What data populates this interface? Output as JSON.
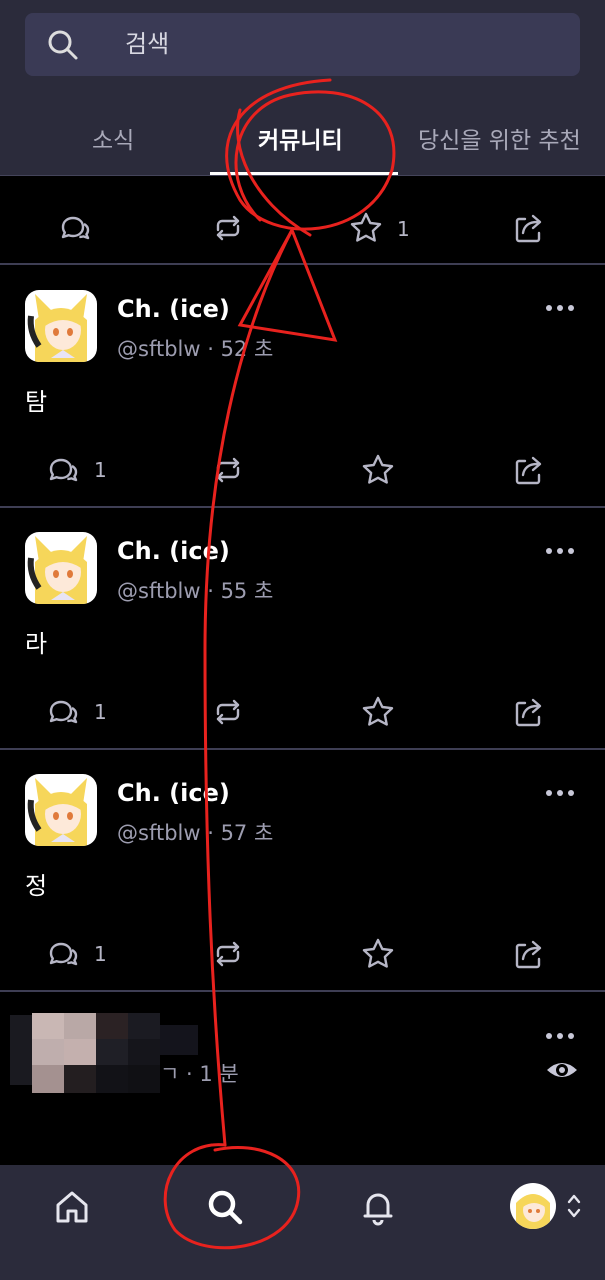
{
  "search": {
    "placeholder": "검색"
  },
  "tabs": [
    {
      "label": "소식",
      "active": false
    },
    {
      "label": "커뮤니티",
      "active": true
    },
    {
      "label": "당신을 위한 추천",
      "active": false
    }
  ],
  "top_partial_post": {
    "favorite_count": "1"
  },
  "posts": [
    {
      "name": "Ch. (ice)",
      "handle": "@sftblw · 52 초",
      "body": "탐",
      "reply_count": "1"
    },
    {
      "name": "Ch. (ice)",
      "handle": "@sftblw · 55 초",
      "body": "라",
      "reply_count": "1"
    },
    {
      "name": "Ch. (ice)",
      "handle": "@sftblw · 57 초",
      "body": "정",
      "reply_count": "1"
    }
  ],
  "obscured_post": {
    "handle_tail": "ㄱ · 1 분"
  },
  "icons": {
    "search": "search-icon",
    "reply": "reply-icon",
    "boost": "boost-icon",
    "favorite": "star-icon",
    "share": "share-icon",
    "more": "more-icon",
    "eye": "eye-icon",
    "home": "home-icon",
    "bell": "bell-icon"
  },
  "colors": {
    "background": "#000000",
    "header": "#2b2b3b",
    "search_field": "#3a3a55",
    "divider": "#3e3e54",
    "annotation": "#e8221e"
  }
}
